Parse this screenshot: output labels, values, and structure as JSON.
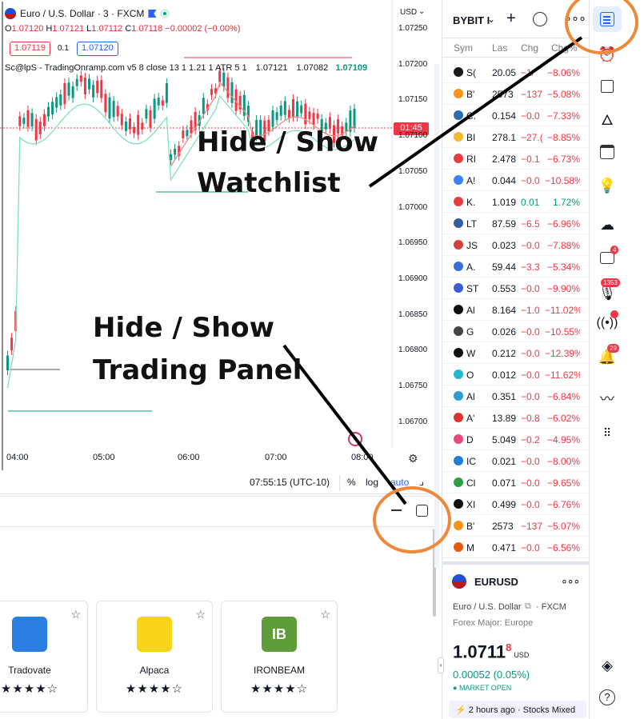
{
  "chart": {
    "symbol_title": "Euro / U.S. Dollar · 3 · FXCM",
    "currency": "USD",
    "ohlc": {
      "o_label": "O",
      "o": "1.07120",
      "h_label": "H",
      "h": "1.07121",
      "l_label": "L",
      "l": "1.07112",
      "c_label": "C",
      "c": "1.07118",
      "change": "−0.00002 (−0.00%)"
    },
    "bid": "1.07119",
    "spread": "0.1",
    "ask": "1.07120",
    "indicator_name": "Sc@lpS - TradingOnramp.com v5 8 close 13 1 1.21 1 ATR 5 1",
    "indicator_values": [
      "1.07121",
      "1.07082",
      "1.07109"
    ],
    "countdown": "01:45",
    "price_axis": [
      "1.07250",
      "1.07200",
      "1.07150",
      "1.07100",
      "1.07050",
      "1.07000",
      "1.06950",
      "1.06900",
      "1.06850",
      "1.06800",
      "1.06750",
      "1.06700"
    ],
    "time_axis": [
      "04:00",
      "05:00",
      "06:00",
      "07:00",
      "08:00"
    ],
    "footer": {
      "clock": "07:55:15 (UTC-10)",
      "percent": "%",
      "log": "log",
      "auto": "auto"
    }
  },
  "annotations": {
    "watchlist_line1": "Hide / Show",
    "watchlist_line2": "Watchlist",
    "panel_line1": "Hide / Show",
    "panel_line2": "Trading Panel",
    "highlight_color": "#f0883a"
  },
  "brokers": [
    {
      "name": "Tradovate",
      "stars": "★★★★☆",
      "logo_color": "#2b7fe0",
      "logo_text": ""
    },
    {
      "name": "Alpaca",
      "stars": "★★★★☆",
      "logo_color": "#f7d417",
      "logo_text": ""
    },
    {
      "name": "IRONBEAM",
      "stars": "★★★★☆",
      "logo_color": "#5e9c3a",
      "logo_text": "IB"
    }
  ],
  "watchlist": {
    "exchange": "BYBIT I",
    "columns": {
      "symbol": "Sym",
      "last": "Las",
      "change": "Chg",
      "change_pct": "Chg%"
    },
    "rows": [
      {
        "sym": "S(",
        "last": "20.05",
        "chg": "−1/",
        "pct": "−8.06%",
        "dir": "neg",
        "color": "#1a1a1a"
      },
      {
        "sym": "B'",
        "last": "2573",
        "chg": "−137",
        "pct": "−5.08%",
        "dir": "neg",
        "color": "#f7931a"
      },
      {
        "sym": "C.",
        "last": "0.154",
        "chg": "−0.0",
        "pct": "−7.33%",
        "dir": "neg",
        "color": "#2b6cb0"
      },
      {
        "sym": "BI",
        "last": "278.1",
        "chg": "−27.(",
        "pct": "−8.85%",
        "dir": "neg",
        "color": "#f3ba2f"
      },
      {
        "sym": "RI",
        "last": "2.478",
        "chg": "−0.1",
        "pct": "−6.73%",
        "dir": "neg",
        "color": "#e53e3e"
      },
      {
        "sym": "A!",
        "last": "0.044",
        "chg": "−0.0",
        "pct": "−10.58%",
        "dir": "neg",
        "color": "#3b82f6"
      },
      {
        "sym": "K.",
        "last": "1.019",
        "chg": "0.01",
        "pct": "1.72%",
        "dir": "pos",
        "color": "#e53e3e"
      },
      {
        "sym": "LT",
        "last": "87.59",
        "chg": "−6.5",
        "pct": "−6.96%",
        "dir": "neg",
        "color": "#345d9d"
      },
      {
        "sym": "JS",
        "last": "0.023",
        "chg": "−0.0",
        "pct": "−7.88%",
        "dir": "neg",
        "color": "#d53f3f"
      },
      {
        "sym": "A.",
        "last": "59.44",
        "chg": "−3.3",
        "pct": "−5.34%",
        "dir": "neg",
        "color": "#3b6fd8"
      },
      {
        "sym": "ST",
        "last": "0.553",
        "chg": "−0.0",
        "pct": "−9.90%",
        "dir": "neg",
        "color": "#3b5bdb"
      },
      {
        "sym": "Al",
        "last": "8.164",
        "chg": "−1.0",
        "pct": "−11.02%",
        "dir": "neg",
        "color": "#111111"
      },
      {
        "sym": "G",
        "last": "0.026",
        "chg": "−0.0",
        "pct": "−10.55%",
        "dir": "neg",
        "color": "#444444"
      },
      {
        "sym": "W",
        "last": "0.212",
        "chg": "−0.0",
        "pct": "−12.39%",
        "dir": "neg",
        "color": "#111111"
      },
      {
        "sym": "O",
        "last": "0.012",
        "chg": "−0.0",
        "pct": "−11.62%",
        "dir": "neg",
        "color": "#22b8cf"
      },
      {
        "sym": "Al",
        "last": "0.351",
        "chg": "−0.0",
        "pct": "−6.84%",
        "dir": "neg",
        "color": "#2e9bd6"
      },
      {
        "sym": "A'",
        "last": "13.89",
        "chg": "−0.8",
        "pct": "−6.02%",
        "dir": "neg",
        "color": "#e03131"
      },
      {
        "sym": "D",
        "last": "5.049",
        "chg": "−0.2",
        "pct": "−4.95%",
        "dir": "neg",
        "color": "#e64980"
      },
      {
        "sym": "IC",
        "last": "0.021",
        "chg": "−0.0",
        "pct": "−8.00%",
        "dir": "neg",
        "color": "#1c7ed6"
      },
      {
        "sym": "Cl",
        "last": "0.071",
        "chg": "−0.0",
        "pct": "−9.65%",
        "dir": "neg",
        "color": "#2f9e44"
      },
      {
        "sym": "XI",
        "last": "0.499",
        "chg": "−0.0",
        "pct": "−6.76%",
        "dir": "neg",
        "color": "#111111"
      },
      {
        "sym": "B'",
        "last": "2573",
        "chg": "−137",
        "pct": "−5.07%",
        "dir": "neg",
        "color": "#f7931a"
      },
      {
        "sym": "M",
        "last": "0.471",
        "chg": "−0.0",
        "pct": "−6.56%",
        "dir": "neg",
        "color": "#e8590c"
      }
    ]
  },
  "details": {
    "symbol": "EURUSD",
    "description": "Euro / U.S. Dollar",
    "exchange": "FXCM",
    "category": "Forex Major: Europe",
    "price_main": "1.0711",
    "price_sup": "8",
    "price_currency": "USD",
    "change": "0.00052 (0.05%)",
    "market_status": "MARKET OPEN",
    "news_time": "2 hours ago",
    "news_tag": "Stocks Mixed"
  },
  "toolbar": {
    "badge_ideas": "4",
    "badge_streams": "1353",
    "badge_alerts": "29"
  }
}
